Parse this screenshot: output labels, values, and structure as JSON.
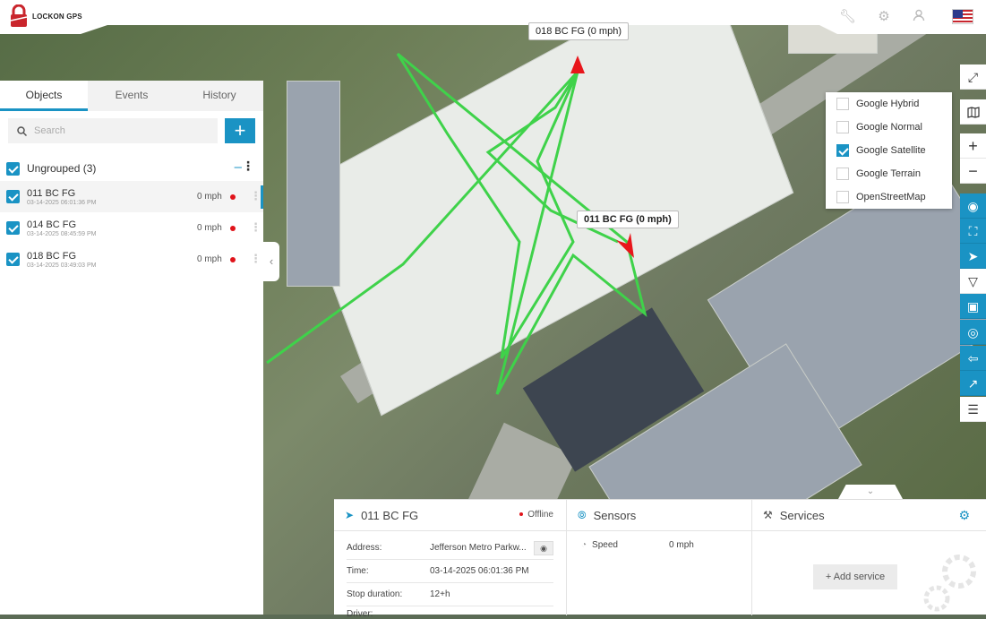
{
  "app": {
    "logo_text": "LOCKON GPS"
  },
  "header_icons": [
    "wrench-icon",
    "gear-icon",
    "user-icon",
    "us-flag-icon"
  ],
  "left_panel": {
    "tabs": [
      {
        "label": "Objects",
        "active": true
      },
      {
        "label": "Events",
        "active": false
      },
      {
        "label": "History",
        "active": false
      }
    ],
    "search": {
      "placeholder": "Search",
      "value": ""
    },
    "add_button": "+",
    "group": {
      "label": "Ungrouped (3)",
      "checked": true
    },
    "objects": [
      {
        "name": "011 BC FG",
        "time": "03-14-2025 06:01:36 PM",
        "speed": "0 mph",
        "status_color": "#e0131a",
        "selected": true
      },
      {
        "name": "014 BC FG",
        "time": "03-14-2025 08:45:59 PM",
        "speed": "0 mph",
        "status_color": "#e0131a",
        "selected": false
      },
      {
        "name": "018 BC FG",
        "time": "03-14-2025 03:49:03 PM",
        "speed": "0 mph",
        "status_color": "#e0131a",
        "selected": false
      }
    ]
  },
  "map": {
    "labels": [
      {
        "text": "018 BC FG (0 mph)"
      },
      {
        "text": "011 BC FG (0 mph)"
      }
    ],
    "track_color": "#3fd24a",
    "marker_color": "#e8161b",
    "map_types": [
      {
        "label": "Google Hybrid",
        "checked": false
      },
      {
        "label": "Google Normal",
        "checked": false
      },
      {
        "label": "Google Satellite",
        "checked": true
      },
      {
        "label": "Google Terrain",
        "checked": false
      },
      {
        "label": "OpenStreetMap",
        "checked": false
      }
    ],
    "toolbar": [
      "fullscreen-icon",
      "map-layers-icon",
      "zoom-in-icon",
      "zoom-out-icon",
      "circle-target-icon",
      "fit-bounds-icon",
      "navigate-icon",
      "routes-icon",
      "lock-icon",
      "place-marker-icon",
      "back-icon",
      "send-icon",
      "traffic-light-icon"
    ]
  },
  "bottom_panel": {
    "object": {
      "name": "011 BC FG",
      "status": "Offline",
      "rows": [
        {
          "key": "Address:",
          "value": "Jefferson Metro Parkw..."
        },
        {
          "key": "Time:",
          "value": "03-14-2025 06:01:36 PM"
        },
        {
          "key": "Stop duration:",
          "value": "12+h"
        },
        {
          "key": "Driver:",
          "value": ""
        }
      ]
    },
    "sensors": {
      "title": "Sensors",
      "rows": [
        {
          "name": "Speed",
          "value": "0 mph"
        }
      ]
    },
    "services": {
      "title": "Services",
      "add_label": "Add service"
    }
  }
}
